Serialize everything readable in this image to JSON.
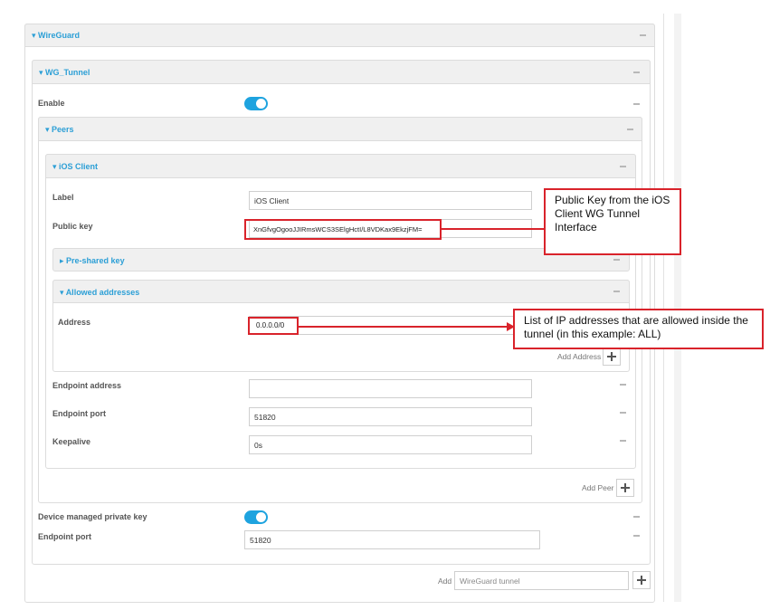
{
  "sections": {
    "wireguard": "WireGuard",
    "wg_tunnel": "WG_Tunnel",
    "peers": "Peers",
    "ios_client": "iOS Client",
    "preshared": "Pre-shared key",
    "allowed": "Allowed addresses"
  },
  "tunnel": {
    "enable_label": "Enable",
    "enable_on": true,
    "device_key_label": "Device managed private key",
    "device_key_on": true,
    "endpoint_port_label": "Endpoint port",
    "endpoint_port_value": "51820"
  },
  "peer": {
    "label_label": "Label",
    "label_value": "iOS Client",
    "public_key_label": "Public key",
    "public_key_value": "XnGfvgOgooJJIRmsWCS3SElgHctI/L8VDKax9EkzjFM=",
    "address_label": "Address",
    "address_value": "0.0.0.0/0",
    "add_address": "Add Address",
    "endpoint_address_label": "Endpoint address",
    "endpoint_address_value": "",
    "endpoint_port_label": "Endpoint port",
    "endpoint_port_value": "51820",
    "keepalive_label": "Keepalive",
    "keepalive_value": "0s"
  },
  "add_peer": "Add Peer",
  "add_tunnel": {
    "label": "Add",
    "placeholder": "WireGuard tunnel"
  },
  "callouts": {
    "public_key": "Public Key from the iOS Client WG Tunnel Interface",
    "allowed": "List of IP addresses that are allowed inside the tunnel (in this example: ALL)"
  },
  "colors": {
    "accent": "#2c9fd6",
    "toggle": "#1ea3df",
    "annotation": "#d9232b"
  }
}
